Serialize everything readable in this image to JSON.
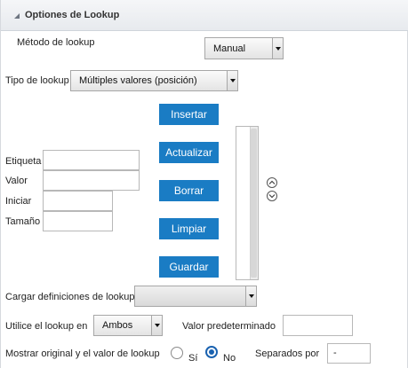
{
  "panel": {
    "title": "Optiones de Lookup"
  },
  "metodo": {
    "label": "Método de lookup",
    "value": "Manual"
  },
  "tipo": {
    "label": "Tipo de lookup",
    "value": "Múltiples valores (posición)"
  },
  "fields": {
    "etiqueta": "Etiqueta",
    "valor": "Valor",
    "iniciar": "Iniciar",
    "tamano": "Tamaño"
  },
  "buttons": {
    "insertar": "Insertar",
    "actualizar": "Actualizar",
    "borrar": "Borrar",
    "limpiar": "Limpiar",
    "guardar": "Guardar"
  },
  "cargar": {
    "label": "Cargar definiciones de lookup",
    "value": ""
  },
  "utilice": {
    "label": "Utilice el lookup en",
    "value": "Ambos"
  },
  "valor_predeterminado": {
    "label": "Valor predeterminado",
    "value": ""
  },
  "mostrar": {
    "label": "Mostrar original y el valor de lookup",
    "options": [
      "Sí",
      "No"
    ],
    "selected": "No"
  },
  "separados": {
    "label": "Separados por",
    "value": "-"
  },
  "icons": {
    "up": "chevron-up-circle-icon",
    "down": "chevron-down-circle-icon"
  },
  "colors": {
    "button": "#1a7cc4",
    "radio": "#1a62b0"
  }
}
